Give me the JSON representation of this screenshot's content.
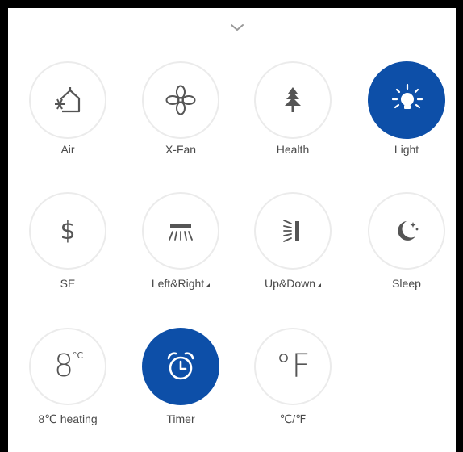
{
  "header": {
    "collapse_icon": "chevron-down-icon"
  },
  "functions": [
    {
      "label": "Air",
      "icon": "house-air-icon",
      "active": false,
      "has_submenu": false
    },
    {
      "label": "X-Fan",
      "icon": "fan-icon",
      "active": false,
      "has_submenu": false
    },
    {
      "label": "Health",
      "icon": "tree-icon",
      "active": false,
      "has_submenu": false
    },
    {
      "label": "Light",
      "icon": "bulb-icon",
      "active": true,
      "has_submenu": false
    },
    {
      "label": "SE",
      "icon_text": "$",
      "icon": "dollar-icon",
      "active": false,
      "has_submenu": false
    },
    {
      "label": "Left&Right",
      "icon": "left-right-swing-icon",
      "active": false,
      "has_submenu": true
    },
    {
      "label": "Up&Down",
      "icon": "up-down-swing-icon",
      "active": false,
      "has_submenu": true
    },
    {
      "label": "Sleep",
      "icon": "moon-icon",
      "active": false,
      "has_submenu": false
    },
    {
      "label": "8℃ heating",
      "icon_text": "8",
      "icon_sup": "°C",
      "icon": "eight-degree-icon",
      "active": false,
      "has_submenu": false
    },
    {
      "label": "Timer",
      "icon": "alarm-clock-icon",
      "active": true,
      "has_submenu": false
    },
    {
      "label": "℃/℉",
      "icon_text": "°F",
      "icon": "fahrenheit-icon",
      "active": false,
      "has_submenu": false
    }
  ],
  "colors": {
    "active": "#0d4fa8",
    "inactive_border": "#ebebeb",
    "icon": "#555555",
    "label": "#4a4a4a"
  }
}
